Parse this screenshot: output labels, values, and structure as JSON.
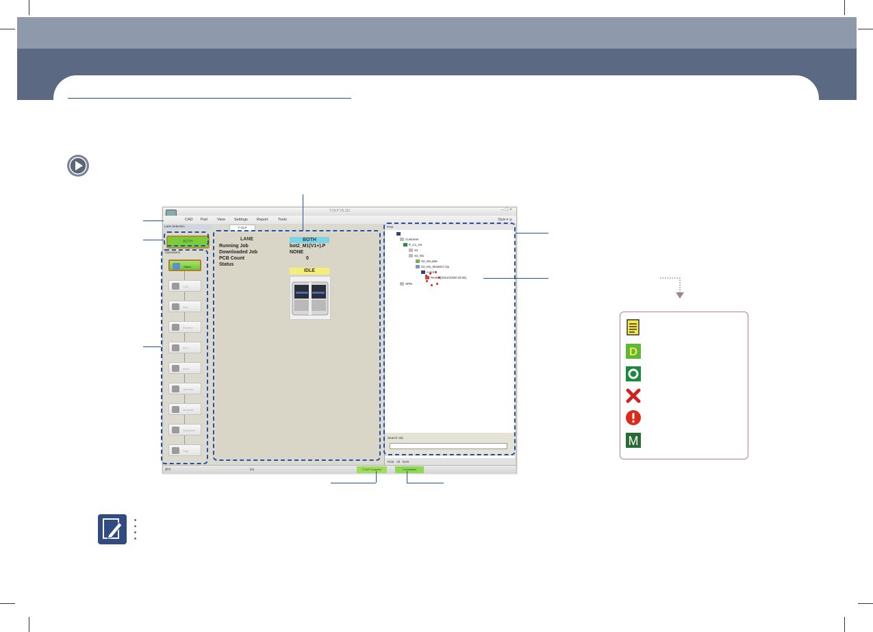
{
  "app": {
    "title": "T-OLP V5.111",
    "win_ctrls": "–  □  ×",
    "menu": [
      "CAD",
      "Part",
      "View",
      "Settings",
      "Report",
      "Tools"
    ],
    "style_ctl": "Style  ▾  ◎",
    "lane_selection_header": "Lane Selection",
    "lane_button": "BOTH",
    "operations_header": "Operations",
    "steps": [
      "Status",
      "CAD",
      "Part",
      "Rotation",
      "PPC",
      "Mark",
      "Optimize",
      "Simulate",
      "Download",
      "Start"
    ],
    "center_tab": "T-OLP",
    "info": {
      "lane_label": "LANE",
      "lane_value": "BOTH",
      "running_job_label": "Running Job",
      "running_job_value": "bot2_M1(V1+).P",
      "downloaded_job_label": "Downloaded Job",
      "downloaded_job_value": "NONE",
      "pcb_count_label": "PCB Count",
      "pcb_count_value": "0",
      "status_label": "Status",
      "status_value": "IDLE"
    },
    "tree_header": "PCB",
    "tree": {
      "customer": "Customer",
      "p_c1_s2": "P_C1_S2",
      "s2": "S2",
      "s2_m1": "S2_M1",
      "s2_m1_pdw": "S2_M1.pdw",
      "s2_m1_model": "S2_M1_Model17.zip",
      "oslot": "o-slot",
      "rev": "Rev99 [2012/10/30 20:05]",
      "spm": "SPM"
    },
    "search_label": "Search Job",
    "tree_status": [
      "PCB",
      "All",
      "ECR"
    ],
    "statusbar": {
      "left": "준비",
      "lane": "M1",
      "tolp_btn": "T-OLP Connect",
      "conn_btn": "Connected"
    }
  },
  "colors": {
    "band_top": "#8e99ab",
    "band_mid": "#5b6a82",
    "callout": "#1f4fa8",
    "legend_border": "#b87d93",
    "lane_green": "#7ccb3b",
    "lane_cyan": "#7dd3e6",
    "idle_yellow": "#f4ef7a"
  },
  "legend_icons": [
    "document-icon",
    "d-icon",
    "o-icon",
    "x-icon",
    "exclamation-icon",
    "m-icon"
  ],
  "legend_letters": {
    "d": "D",
    "m": "M"
  }
}
